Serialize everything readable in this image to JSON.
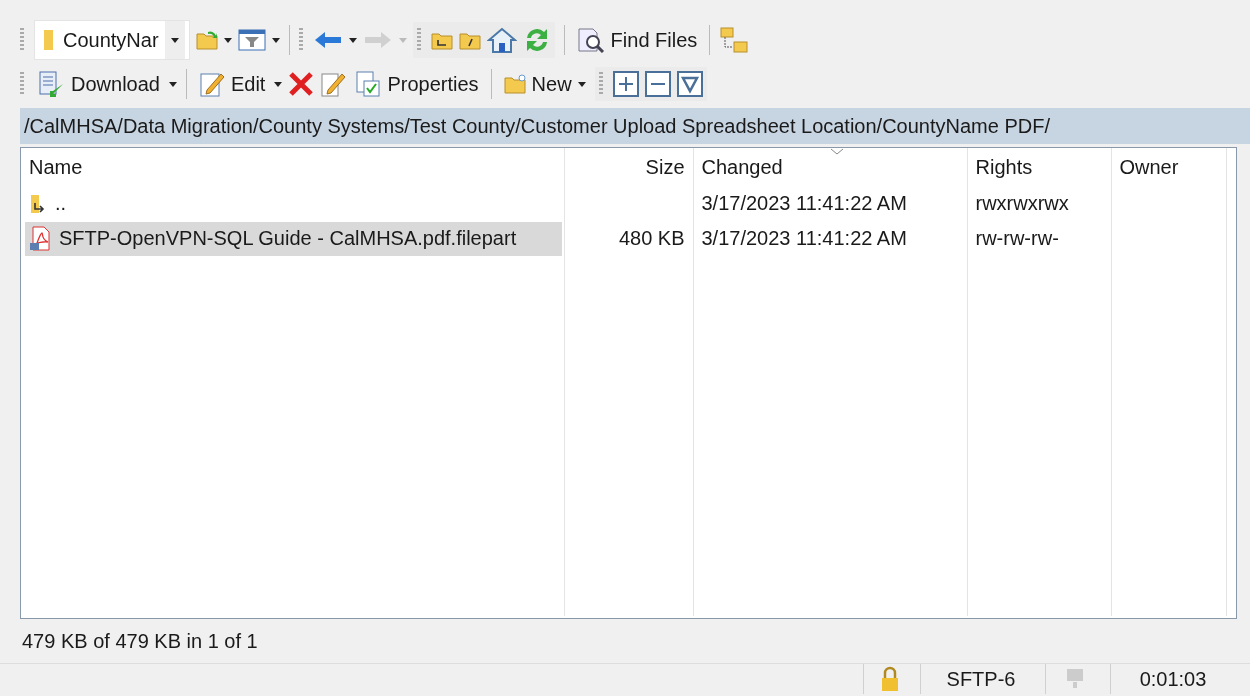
{
  "toolbar_top": {
    "folder_box": "CountyNar",
    "back": {
      "disabled": false
    },
    "forward": {
      "disabled": true
    },
    "find_files": "Find Files"
  },
  "toolbar_bottom": {
    "download": "Download",
    "edit": "Edit",
    "properties": "Properties",
    "new": "New"
  },
  "path": "/CalMHSA/Data Migration/County Systems/Test County/Customer Upload Spreadsheet Location/CountyName PDF/",
  "columns": [
    {
      "label": "Name",
      "sorted": false
    },
    {
      "label": "Size",
      "sorted": false
    },
    {
      "label": "Changed",
      "sorted": true
    },
    {
      "label": "Rights",
      "sorted": false
    },
    {
      "label": "Owner",
      "sorted": false
    }
  ],
  "rows": [
    {
      "kind": "parent",
      "name": "..",
      "size": "",
      "changed": "3/17/2023 11:41:22 AM",
      "rights": "rwxrwxrwx",
      "selected": false
    },
    {
      "kind": "pdf",
      "name": "SFTP-OpenVPN-SQL Guide - CalMHSA.pdf.filepart",
      "size": "480 KB",
      "changed": "3/17/2023 11:41:22 AM",
      "rights": "rw-rw-rw-",
      "selected": true
    }
  ],
  "summary": "479 KB of 479 KB in 1 of 1",
  "status_bar": {
    "protocol": "SFTP-6",
    "elapsed": "0:01:03"
  }
}
